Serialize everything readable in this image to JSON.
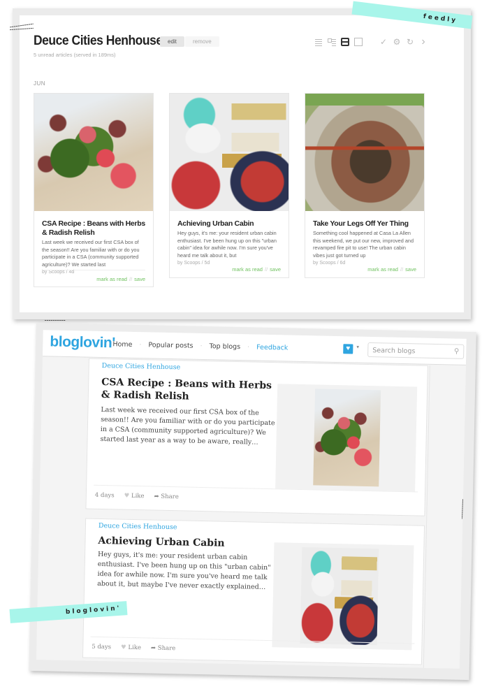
{
  "feedly": {
    "tape_label": "feedly",
    "title": "Deuce Cities Henhouse",
    "edit_label": "edit",
    "remove_label": "remove",
    "subtitle": "5 unread articles (served in 189ms)",
    "month": "JUN",
    "toolbar_icons": [
      "list-view-icon",
      "title-view-icon",
      "magazine-view-icon",
      "cards-view-icon",
      "checkmark-icon",
      "gear-icon",
      "refresh-icon",
      "chevron-right-icon"
    ],
    "toolbar_glyphs": {
      "check": "✓",
      "gear": "⚙",
      "refresh": "↻",
      "next": "›"
    },
    "cards": [
      {
        "title": "CSA Recipe : Beans with Herbs & Radish Relish",
        "summary": "Last week we received our first CSA box of the season!! Are you familiar with or do you participate in a CSA (community supported agriculture)? We started last",
        "meta": "by Scoops / 4d",
        "mark_read": "mark as read",
        "separator": "//",
        "save": "save",
        "image": "food-photo"
      },
      {
        "title": "Achieving Urban Cabin",
        "summary": "Hey guys, it's me: your resident urban cabin enthusiast. I've been hung up on this \"urban cabin\" idea for awhile now. I'm sure you've heard me talk about it, but",
        "meta": "by Scoops / 5d",
        "mark_read": "mark as read",
        "separator": "//",
        "save": "save",
        "image": "urban-cabin-collage"
      },
      {
        "title": "Take Your Legs Off Yer Thing",
        "summary": "Something cool happened at Casa La Allen this weekend, we put our new, improved and revamped fire pit to use! The urban cabin vibes just got turned up",
        "meta": "by Scoops / 6d",
        "mark_read": "mark as read",
        "separator": "//",
        "save": "save",
        "image": "fire-pit-photo"
      }
    ]
  },
  "bloglovin": {
    "tape_label": "bloglovin'",
    "logo": "bloglovin'",
    "nav": [
      "Home",
      "Popular posts",
      "Top blogs"
    ],
    "nav_sep": "·",
    "feedback": "Feedback",
    "heart_glyph": "♥",
    "caret_glyph": "▾",
    "search_placeholder": "Search blogs",
    "search_glyph": "⚲",
    "accent_color": "#2fa5e0",
    "posts": [
      {
        "blog": "Deuce Cities Henhouse",
        "title": "CSA Recipe : Beans with Herbs & Radish Relish",
        "body": "Last week we received our first CSA box of the season!! Are you familiar with or do you participate in a CSA (community supported agriculture)? We started last year as a way to be aware, really…",
        "age": "4 days",
        "like": "Like",
        "share": "Share"
      },
      {
        "blog": "Deuce Cities Henhouse",
        "title": "Achieving Urban Cabin",
        "body": "Hey guys, it's me: your resident urban cabin enthusiast. I've been hung up on this \"urban cabin\" idea for awhile now. I'm sure you've heard me talk about it, but maybe I've never exactly explained…",
        "age": "5 days",
        "like": "Like",
        "share": "Share"
      }
    ],
    "like_glyph": "♥",
    "share_glyph": "➦"
  },
  "colors": {
    "tape": "#a8f5ea",
    "feedly_green": "#6fc15f",
    "bloglovin_blue": "#2fa5e0"
  }
}
